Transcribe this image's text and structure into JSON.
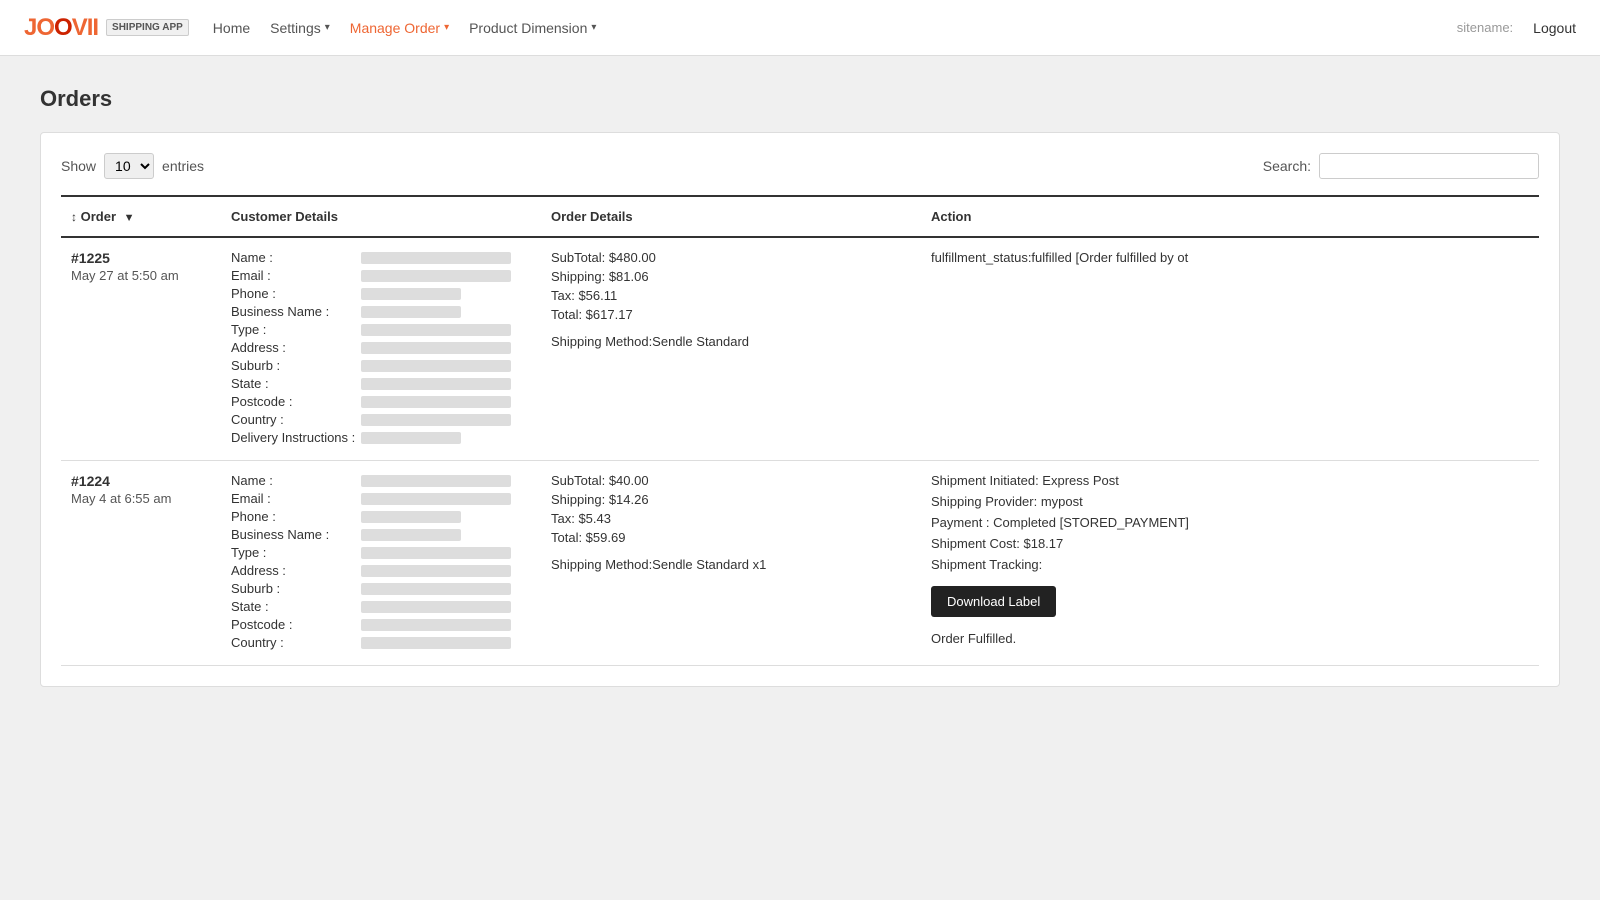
{
  "brand": {
    "logo": "JOOVII",
    "tag": "SHIPPING APP"
  },
  "nav": {
    "home": "Home",
    "settings": "Settings",
    "manage_order": "Manage Order",
    "product_dimension": "Product Dimension",
    "sitename_label": "sitename:",
    "logout": "Logout"
  },
  "page": {
    "title": "Orders"
  },
  "table_controls": {
    "show_label": "Show",
    "entries_value": "10",
    "entries_label": "entries",
    "search_label": "Search:"
  },
  "table": {
    "headers": {
      "order": "Order",
      "customer_details": "Customer Details",
      "order_details": "Order Details",
      "action": "Action"
    },
    "rows": [
      {
        "order_number": "#1225",
        "order_date": "May 27 at 5:50 am",
        "customer_fields": [
          "Name :",
          "Email :",
          "Phone :",
          "Business Name :",
          "Type :",
          "Address :",
          "Suburb :",
          "State :",
          "Postcode :",
          "Country :",
          "Delivery Instructions :"
        ],
        "order_details": [
          "SubTotal: $480.00",
          "Shipping: $81.06",
          "Tax: $56.11",
          "Total: $617.17",
          "",
          "Shipping Method:Sendle Standard"
        ],
        "action_text": "fulfillment_status:fulfilled [Order fulfilled by ot",
        "has_download": false,
        "fulfilled_text": ""
      },
      {
        "order_number": "#1224",
        "order_date": "May 4 at 6:55 am",
        "customer_fields": [
          "Name :",
          "Email :",
          "Phone :",
          "Business Name :",
          "Type :",
          "Address :",
          "Suburb :",
          "State :",
          "Postcode :",
          "Country :"
        ],
        "order_details": [
          "SubTotal: $40.00",
          "Shipping: $14.26",
          "Tax: $5.43",
          "Total: $59.69",
          "",
          "Shipping Method:Sendle Standard x1"
        ],
        "action_lines": [
          "Shipment Initiated: Express Post",
          "Shipping Provider: mypost",
          "Payment : Completed [STORED_PAYMENT]",
          "Shipment Cost: $18.17",
          "Shipment Tracking:"
        ],
        "has_download": true,
        "download_label": "Download Label",
        "fulfilled_text": "Order Fulfilled."
      }
    ]
  }
}
